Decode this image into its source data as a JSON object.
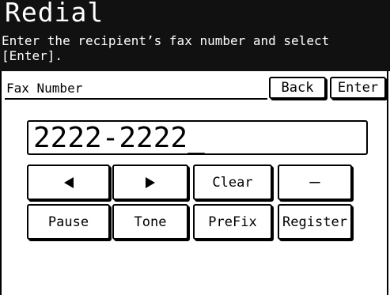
{
  "header": {
    "title": "Redial",
    "instruction": "Enter the recipient’s fax number and select [Enter]."
  },
  "form": {
    "field_label": "Fax Number",
    "fax_number_value": "2222-2222_"
  },
  "buttons": {
    "back": "Back",
    "enter": "Enter",
    "clear": "Clear",
    "dash": "–",
    "pause": "Pause",
    "tone": "Tone",
    "prefix": "PreFix",
    "register": "Register"
  },
  "icons": {
    "left_arrow": "arrow-left-icon",
    "right_arrow": "arrow-right-icon"
  },
  "colors": {
    "header_bg": "#111111",
    "header_text": "#ffffff",
    "foreground": "#000000",
    "background": "#ffffff"
  }
}
